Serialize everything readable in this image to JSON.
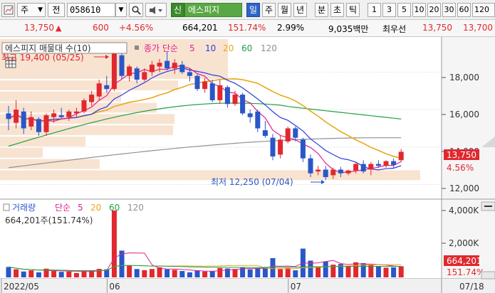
{
  "toolbar": {
    "type_label": "주",
    "prev_label": "전",
    "code": "058610",
    "name_prefix": "신",
    "stock_name": "에스피지",
    "tabs": [
      "일",
      "주",
      "월",
      "년",
      "분",
      "초",
      "틱"
    ],
    "active_tab": "일",
    "periods": [
      "1",
      "3",
      "5",
      "10",
      "20",
      "30",
      "60",
      "120"
    ]
  },
  "quote": {
    "price": "13,750",
    "change": "600",
    "change_pct": "+4.56%",
    "volume": "664,201",
    "volume_ratio": "151.74%",
    "turnover": "2.99%",
    "amount": "9,035백만",
    "priority_ask_label": "최우선",
    "ask": "13,750",
    "bid": "13,700"
  },
  "price_panel": {
    "title": "에스피지 매물대 수(10)",
    "ma_title": "종가 단순",
    "ma_periods": [
      "5",
      "10",
      "20",
      "60",
      "120"
    ],
    "high_label": "최고 19,400 (05/25)",
    "low_label": "최저 12,250 (07/04)",
    "y_ticks": [
      "18,000",
      "16,000",
      "14,000",
      "12,000"
    ],
    "current_label": "13,750",
    "current_pct": "4.56%"
  },
  "volume_panel": {
    "title": "거래량",
    "ma_title": "단순",
    "ma_periods": [
      "5",
      "20",
      "60",
      "120"
    ],
    "summary": "664,201주(151.74%)",
    "y_ticks": [
      "4,000K",
      "2,000K"
    ],
    "current_label": "664,201",
    "current_pct": "151.74%"
  },
  "x_axis": {
    "labels": [
      {
        "text": "2022/05",
        "index": 0
      },
      {
        "text": "06",
        "index": 14
      },
      {
        "text": "07",
        "index": 38
      }
    ],
    "right_label": "07/18"
  },
  "colors": {
    "up": "#e0282e",
    "down": "#2a56c8",
    "ma5": "#e02090",
    "ma10": "#2a3ce0",
    "ma20": "#e8a818",
    "ma60": "#20a040",
    "ma120": "#909090",
    "volume_profile": "#f7e0cc"
  },
  "chart_data": {
    "type": "candlestick",
    "y_range": [
      11300,
      19800
    ],
    "candles": [
      {
        "o": 15800,
        "h": 16200,
        "l": 14900,
        "c": 15500
      },
      {
        "o": 15300,
        "h": 16500,
        "l": 15000,
        "c": 16000
      },
      {
        "o": 15900,
        "h": 16100,
        "l": 14700,
        "c": 15000
      },
      {
        "o": 15100,
        "h": 15900,
        "l": 14900,
        "c": 15600
      },
      {
        "o": 15500,
        "h": 15600,
        "l": 14600,
        "c": 14800
      },
      {
        "o": 14800,
        "h": 15800,
        "l": 14600,
        "c": 15700
      },
      {
        "o": 15600,
        "h": 16000,
        "l": 15300,
        "c": 15800
      },
      {
        "o": 15700,
        "h": 16100,
        "l": 15500,
        "c": 15600
      },
      {
        "o": 15600,
        "h": 16000,
        "l": 15400,
        "c": 15900
      },
      {
        "o": 15800,
        "h": 16100,
        "l": 15600,
        "c": 15900
      },
      {
        "o": 15900,
        "h": 16600,
        "l": 15800,
        "c": 16500
      },
      {
        "o": 16400,
        "h": 17000,
        "l": 16200,
        "c": 16800
      },
      {
        "o": 16700,
        "h": 17600,
        "l": 16500,
        "c": 17400
      },
      {
        "o": 17300,
        "h": 17800,
        "l": 16900,
        "c": 17100
      },
      {
        "o": 17100,
        "h": 19400,
        "l": 17000,
        "c": 19000
      },
      {
        "o": 18900,
        "h": 19200,
        "l": 17600,
        "c": 17800
      },
      {
        "o": 17800,
        "h": 18400,
        "l": 17500,
        "c": 18300
      },
      {
        "o": 18200,
        "h": 18300,
        "l": 17400,
        "c": 17600
      },
      {
        "o": 17600,
        "h": 18200,
        "l": 17500,
        "c": 18000
      },
      {
        "o": 18000,
        "h": 18600,
        "l": 17800,
        "c": 18400
      },
      {
        "o": 18300,
        "h": 18700,
        "l": 18000,
        "c": 18500
      },
      {
        "o": 18600,
        "h": 19100,
        "l": 18100,
        "c": 18200
      },
      {
        "o": 18200,
        "h": 18700,
        "l": 17900,
        "c": 18500
      },
      {
        "o": 18400,
        "h": 18600,
        "l": 17900,
        "c": 18000
      },
      {
        "o": 18000,
        "h": 18200,
        "l": 17500,
        "c": 17800
      },
      {
        "o": 17800,
        "h": 17900,
        "l": 17000,
        "c": 17100
      },
      {
        "o": 17100,
        "h": 17700,
        "l": 16900,
        "c": 17500
      },
      {
        "o": 17400,
        "h": 17600,
        "l": 16400,
        "c": 16500
      },
      {
        "o": 16500,
        "h": 17600,
        "l": 16300,
        "c": 17300
      },
      {
        "o": 17200,
        "h": 17300,
        "l": 16100,
        "c": 16300
      },
      {
        "o": 16300,
        "h": 17000,
        "l": 16200,
        "c": 16800
      },
      {
        "o": 16800,
        "h": 16900,
        "l": 15700,
        "c": 15800
      },
      {
        "o": 15800,
        "h": 16000,
        "l": 15300,
        "c": 15600
      },
      {
        "o": 15900,
        "h": 16000,
        "l": 14800,
        "c": 15000
      },
      {
        "o": 14900,
        "h": 15400,
        "l": 14500,
        "c": 14600
      },
      {
        "o": 14500,
        "h": 14700,
        "l": 13300,
        "c": 13500
      },
      {
        "o": 13600,
        "h": 14600,
        "l": 13400,
        "c": 14400
      },
      {
        "o": 14300,
        "h": 15100,
        "l": 14200,
        "c": 15000
      },
      {
        "o": 15000,
        "h": 15100,
        "l": 14300,
        "c": 14500
      },
      {
        "o": 14400,
        "h": 14500,
        "l": 13200,
        "c": 13400
      },
      {
        "o": 13400,
        "h": 13600,
        "l": 12400,
        "c": 12600
      },
      {
        "o": 12700,
        "h": 13000,
        "l": 12500,
        "c": 12800
      },
      {
        "o": 12800,
        "h": 13000,
        "l": 12250,
        "c": 12400
      },
      {
        "o": 12500,
        "h": 12900,
        "l": 12300,
        "c": 12800
      },
      {
        "o": 12800,
        "h": 12950,
        "l": 12400,
        "c": 12600
      },
      {
        "o": 12600,
        "h": 12800,
        "l": 12500,
        "c": 12750
      },
      {
        "o": 12750,
        "h": 13200,
        "l": 12600,
        "c": 13100
      },
      {
        "o": 13100,
        "h": 13300,
        "l": 12600,
        "c": 12700
      },
      {
        "o": 12800,
        "h": 13200,
        "l": 12500,
        "c": 13100
      },
      {
        "o": 13100,
        "h": 13300,
        "l": 12900,
        "c": 13000
      },
      {
        "o": 13000,
        "h": 13300,
        "l": 12900,
        "c": 13250
      },
      {
        "o": 13250,
        "h": 13400,
        "l": 12900,
        "c": 13050
      },
      {
        "o": 13300,
        "h": 13900,
        "l": 13200,
        "c": 13750
      }
    ],
    "volume": [
      620,
      480,
      350,
      420,
      300,
      520,
      380,
      330,
      350,
      260,
      400,
      420,
      510,
      480,
      4000,
      1600,
      720,
      500,
      430,
      500,
      600,
      480,
      450,
      380,
      300,
      420,
      350,
      380,
      560,
      530,
      500,
      580,
      480,
      560,
      620,
      1150,
      500,
      560,
      420,
      1720,
      1000,
      640,
      950,
      760,
      800,
      680,
      900,
      850,
      730,
      640,
      580,
      600,
      664
    ],
    "ma_close": {
      "ma20_end": 13600,
      "ma60_end": 15700,
      "ma120_end": 14100
    }
  }
}
